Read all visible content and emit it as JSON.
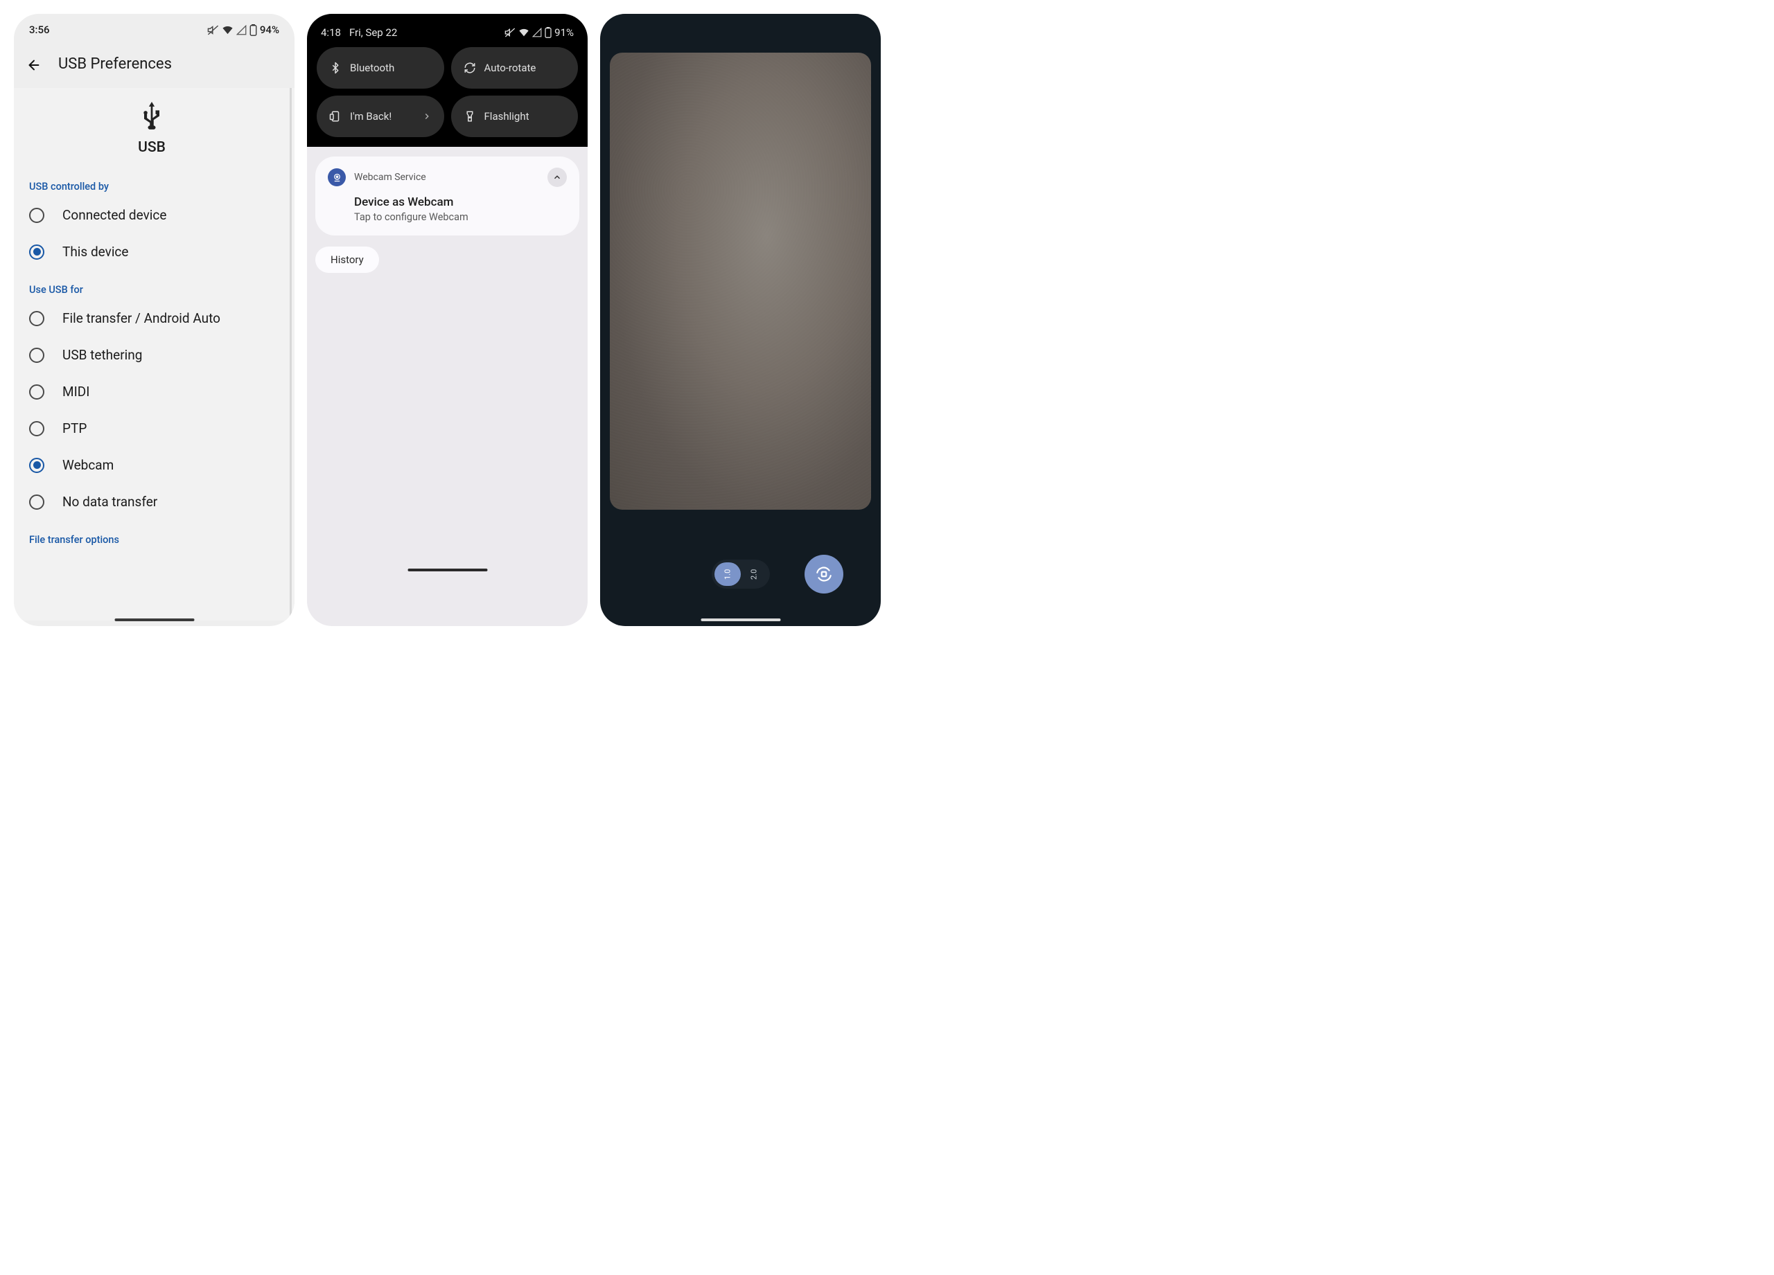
{
  "screen1": {
    "status": {
      "time": "3:56",
      "battery": "94%"
    },
    "header": {
      "title": "USB Preferences"
    },
    "hero": {
      "label": "USB"
    },
    "section_controlled": "USB controlled by",
    "radios_controlled": [
      {
        "label": "Connected device",
        "checked": false
      },
      {
        "label": "This device",
        "checked": true
      }
    ],
    "section_use": "Use USB for",
    "radios_use": [
      {
        "label": "File transfer / Android Auto",
        "checked": false
      },
      {
        "label": "USB tethering",
        "checked": false
      },
      {
        "label": "MIDI",
        "checked": false
      },
      {
        "label": "PTP",
        "checked": false
      },
      {
        "label": "Webcam",
        "checked": true
      },
      {
        "label": "No data transfer",
        "checked": false
      }
    ],
    "section_transfer": "File transfer options"
  },
  "screen2": {
    "status": {
      "time": "4:18",
      "date": "Fri, Sep 22",
      "battery": "91%"
    },
    "tiles": [
      {
        "label": "Bluetooth",
        "icon": "bluetooth-icon"
      },
      {
        "label": "Auto-rotate",
        "icon": "autorotate-icon"
      },
      {
        "label": "I'm Back!",
        "icon": "screen-icon",
        "chevron": true
      },
      {
        "label": "Flashlight",
        "icon": "flashlight-icon"
      }
    ],
    "notification": {
      "app": "Webcam Service",
      "title": "Device as Webcam",
      "body": "Tap to configure Webcam"
    },
    "chip": "History"
  },
  "screen3": {
    "zoom": [
      {
        "label": "1.0",
        "active": true
      },
      {
        "label": "2.0",
        "active": false
      }
    ]
  }
}
